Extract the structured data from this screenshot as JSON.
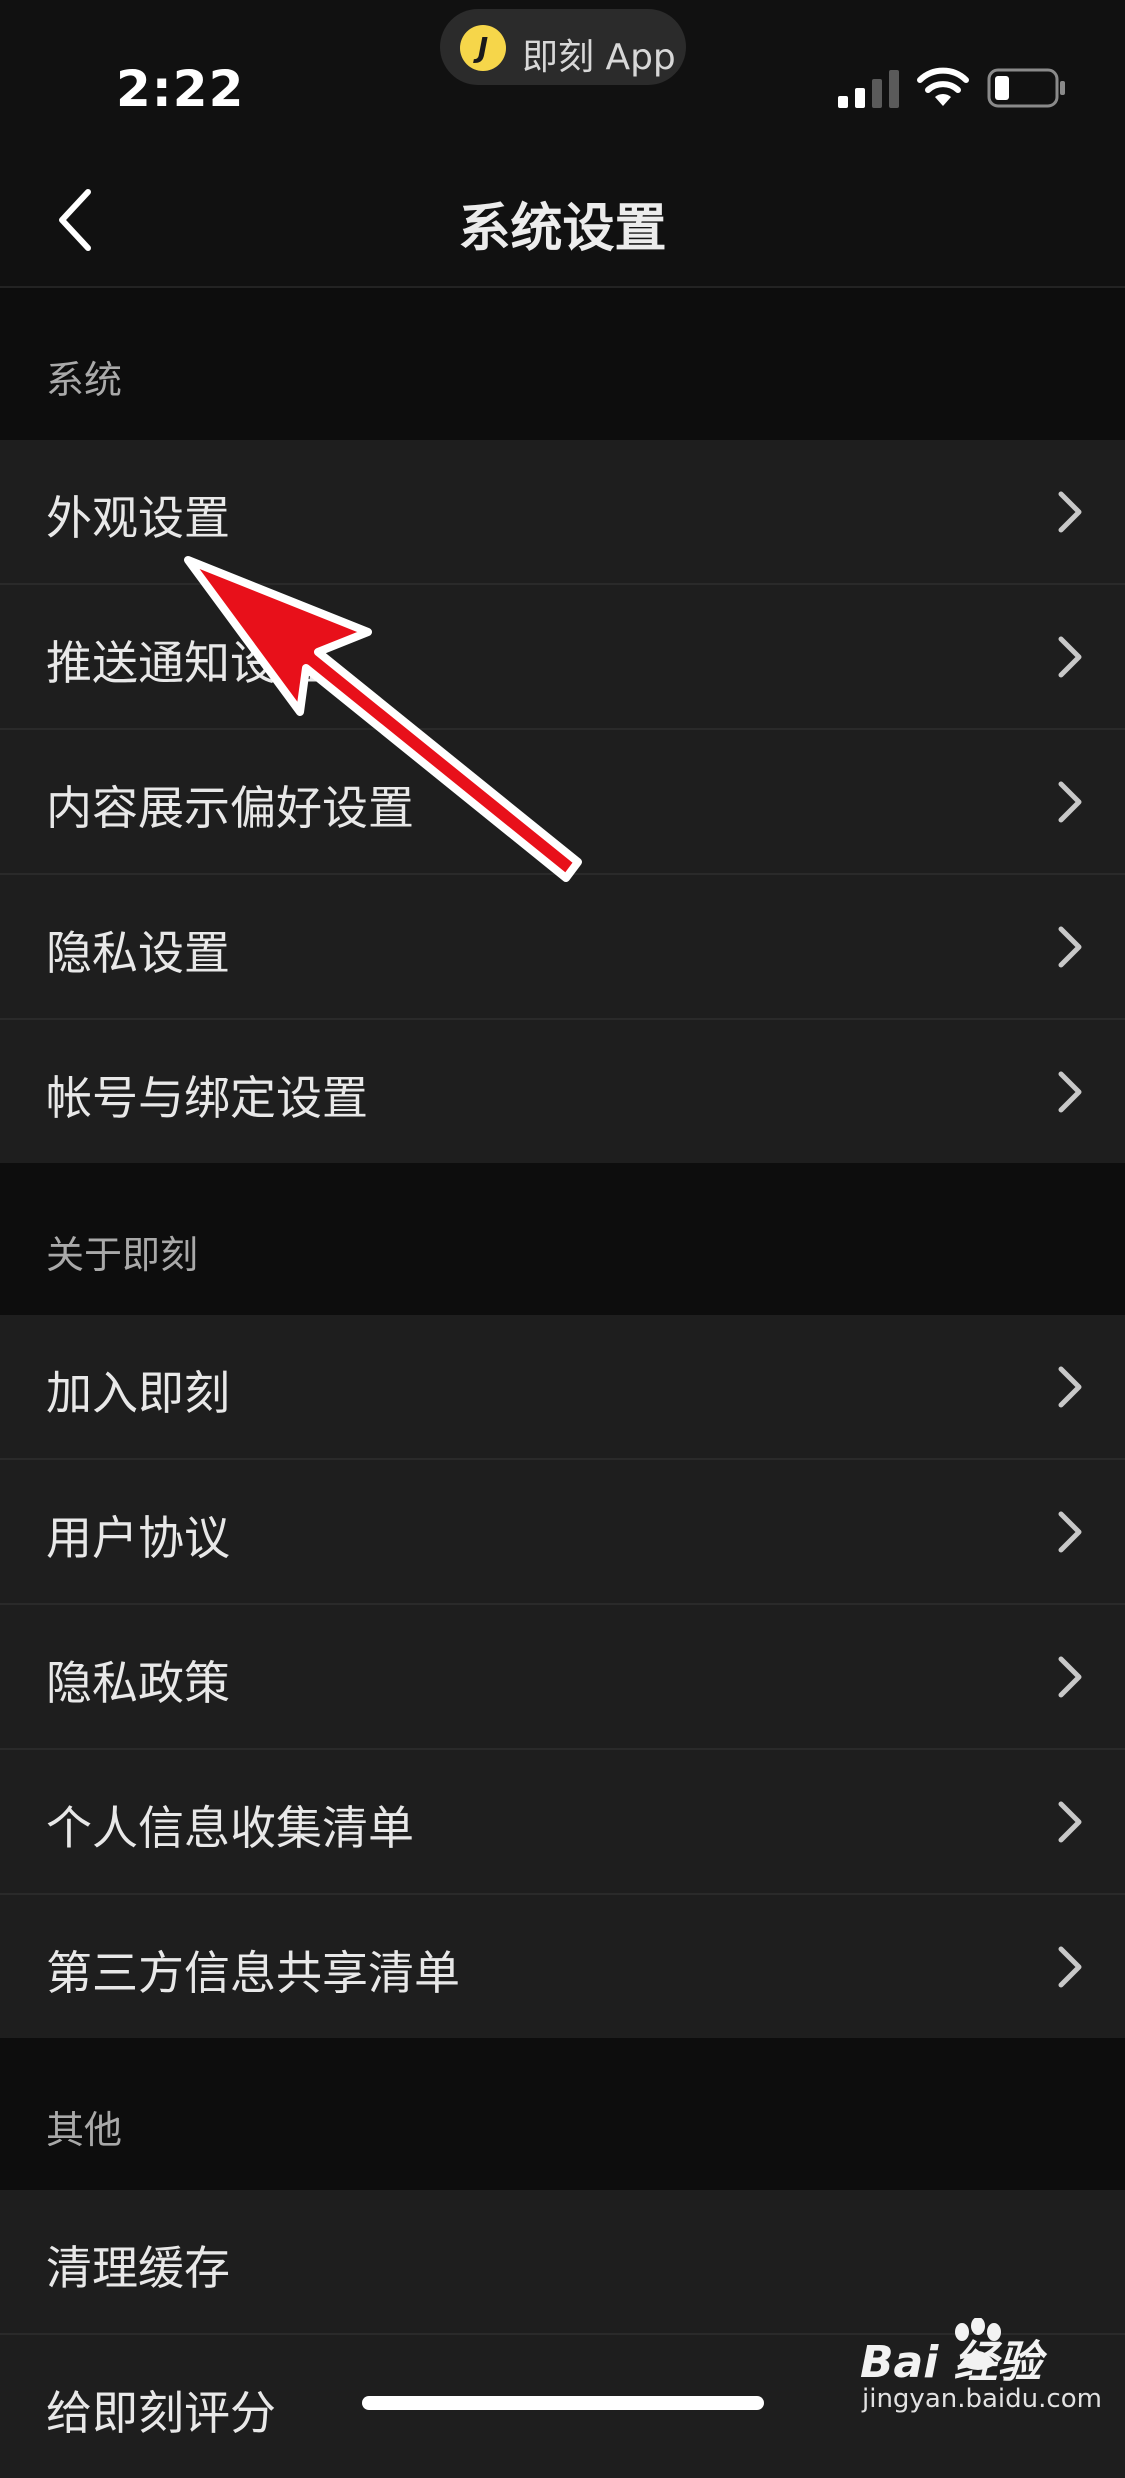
{
  "status_bar": {
    "time": "2:22",
    "app_pill": {
      "logo_letter": "J",
      "label": "即刻 App"
    }
  },
  "nav": {
    "title": "系统设置"
  },
  "sections": [
    {
      "header": "系统",
      "items": [
        {
          "label": "外观设置"
        },
        {
          "label": "推送通知设置"
        },
        {
          "label": "内容展示偏好设置"
        },
        {
          "label": "隐私设置"
        },
        {
          "label": "帐号与绑定设置"
        }
      ]
    },
    {
      "header": "关于即刻",
      "items": [
        {
          "label": "加入即刻"
        },
        {
          "label": "用户协议"
        },
        {
          "label": "隐私政策"
        },
        {
          "label": "个人信息收集清单"
        },
        {
          "label": "第三方信息共享清单"
        }
      ]
    },
    {
      "header": "其他",
      "items": [
        {
          "label": "清理缓存"
        },
        {
          "label": "给即刻评分"
        }
      ]
    }
  ],
  "watermark": {
    "brand": "Bai  经验",
    "url": "jingyan.baidu.com"
  },
  "colors": {
    "background": "#111111",
    "row_background": "#1e1e1e",
    "section_background": "#0d0d0d",
    "annotation_arrow": "#e8101a",
    "app_logo": "#f6d64a"
  }
}
